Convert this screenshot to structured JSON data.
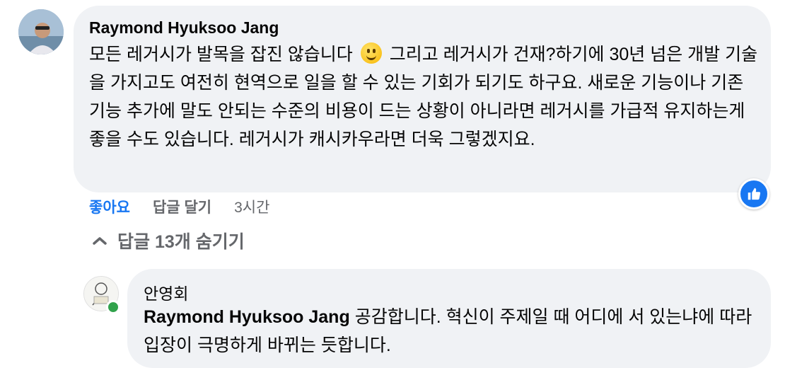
{
  "comment": {
    "author": "Raymond Hyuksoo Jang",
    "text_before_emoji": "모든 레거시가 발목을 잡진 않습니다",
    "emoji": "smiling-face-emoji",
    "text_after_emoji": "그리고 레거시가 건재?하기에 30년 넘은 개발 기술을 가지고도 여전히 현역으로 일을 할 수 있는 기회가 되기도 하구요. 새로운 기능이나 기존 기능 추가에 말도 안되는 수준의 비용이 드는 상황이 아니라면 레거시를 가급적 유지하는게 좋을 수도 있습니다. 레거시가 캐시카우라면 더욱 그렇겠지요.",
    "actions": {
      "like": "좋아요",
      "reply": "답글 달기",
      "time": "3시간"
    },
    "reaction": "like-icon",
    "hide_replies": "답글 13개 숨기기"
  },
  "reply": {
    "author": "안영회",
    "tagged_user": "Raymond Hyuksoo Jang",
    "text": "공감합니다. 혁신이 주제일 때 어디에 서 있는냐에 따라 입장이 극명하게 바뀌는 듯합니다.",
    "online": true
  },
  "colors": {
    "accent": "#1877f2",
    "bubble": "#f0f2f5",
    "muted": "#65676b",
    "online": "#31a24c"
  }
}
